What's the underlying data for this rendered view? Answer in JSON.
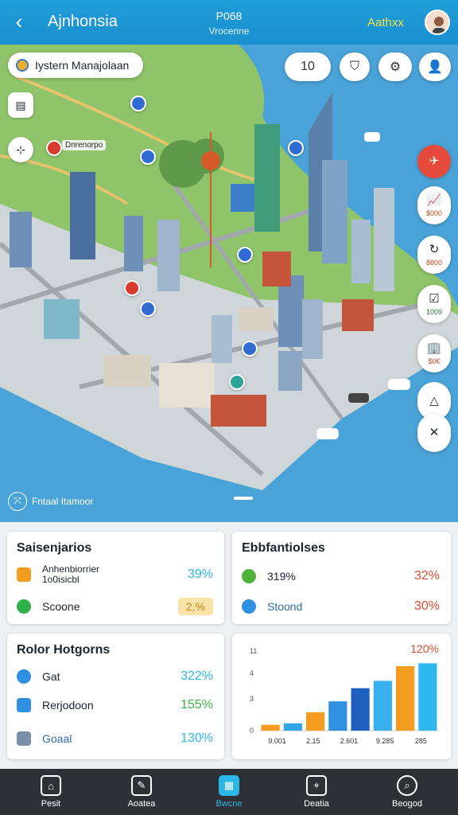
{
  "header": {
    "back_icon": "chevron-left-icon",
    "title": "Ajnhonsia",
    "center_title": "P068",
    "center_subtitle": "Vrocenne",
    "right_link": "Aathxx",
    "avatar_icon": "user-avatar",
    "colors": {
      "bar": "#1a8fcf",
      "link": "#f5e14a"
    }
  },
  "map": {
    "chip_label": "Iystern Manajolaan",
    "zoom_label": "10",
    "top_buttons": [
      "shield-icon",
      "gear-icon",
      "user-icon"
    ],
    "tools": [
      "layers-icon",
      "locate-icon"
    ],
    "labels": [
      "Dnrenorpo"
    ],
    "rail": [
      {
        "icon": "navigate-icon",
        "value": ""
      },
      {
        "icon": "chart-icon",
        "value": "$000"
      },
      {
        "icon": "refresh-icon",
        "value": "8800"
      },
      {
        "icon": "document-icon",
        "value": "1009"
      },
      {
        "icon": "building-icon",
        "value": "$0€"
      },
      {
        "icon": "ruler-icon",
        "value": ""
      },
      {
        "icon": "close-icon",
        "value": ""
      }
    ],
    "measure_label": "Fntaal Itamoor"
  },
  "cards": {
    "card1": {
      "title": "Saisenjarios",
      "rows": [
        {
          "label_line1": "Anhenbiorrier",
          "label_line2": "1o0isicbl",
          "value": "39%",
          "color": "#2bb7e6",
          "icon_color": "#f39c1f"
        },
        {
          "label": "Scoone",
          "value": "2,%",
          "color": "#c78a1a",
          "icon_color": "#2fb04a"
        }
      ]
    },
    "card2": {
      "title": "Ebbfantiolses",
      "rows": [
        {
          "label": "319%",
          "value": "32%",
          "color": "#e04a2f",
          "icon_color": "#4fb33a"
        },
        {
          "label": "Stoond",
          "value": "30%",
          "color": "#e04a2f",
          "icon_color": "#2f8fe0"
        }
      ]
    },
    "card3": {
      "title": "Rolor Hotgorns",
      "rows": [
        {
          "label": "Gat",
          "value": "322%",
          "color": "#2bb7e6",
          "icon_color": "#2f8fe0"
        },
        {
          "label": "Rerjodoon",
          "value": "155%",
          "color": "#39b54a",
          "icon_color": "#2f8fe0"
        },
        {
          "label": "Goaal",
          "value": "130%",
          "color": "#2bb7e6",
          "icon_color": "#7b8fa8"
        }
      ]
    }
  },
  "chart_data": {
    "type": "bar",
    "title": "120%",
    "y_ticks": [
      "11",
      "4",
      "3",
      "0"
    ],
    "categories": [
      "9.001",
      "2.15",
      "2.601",
      "9.285",
      "285"
    ],
    "values": [
      8,
      10,
      25,
      40,
      58,
      68,
      88,
      92
    ],
    "colors": [
      "#f39c1f",
      "#2fa7e6",
      "#f39c1f",
      "#2f8fe0",
      "#1f5fc0",
      "#39b0ee",
      "#f39c1f",
      "#2fb8f0"
    ],
    "ylim": [
      0,
      100
    ]
  },
  "nav": [
    {
      "label": "Pesit",
      "icon": "home-icon"
    },
    {
      "label": "Aoatea",
      "icon": "edit-icon"
    },
    {
      "label": "Bwcne",
      "icon": "map-icon",
      "active": true
    },
    {
      "label": "Deatia",
      "icon": "location-icon"
    },
    {
      "label": "Beogod",
      "icon": "search-icon"
    }
  ]
}
